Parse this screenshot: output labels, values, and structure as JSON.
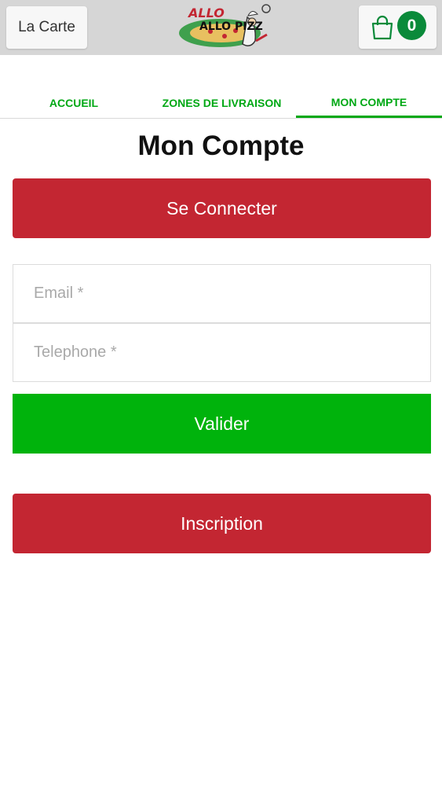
{
  "header": {
    "carte_label": "La Carte",
    "logo_text": "ALLO PIZZ",
    "cart_count": "0"
  },
  "tabs": [
    {
      "label": "ACCUEIL",
      "active": false
    },
    {
      "label": "ZONES DE LIVRAISON",
      "active": false
    },
    {
      "label": "MON COMPTE",
      "active": true
    }
  ],
  "main": {
    "title": "Mon Compte",
    "login_label": "Se Connecter",
    "email_placeholder": "Email *",
    "email_value": "",
    "phone_placeholder": "Telephone *",
    "phone_value": "",
    "submit_label": "Valider",
    "register_label": "Inscription"
  },
  "colors": {
    "accent_green": "#00a814",
    "button_red": "#c32632",
    "button_green": "#00b30c",
    "badge_green": "#0a8a3a"
  }
}
